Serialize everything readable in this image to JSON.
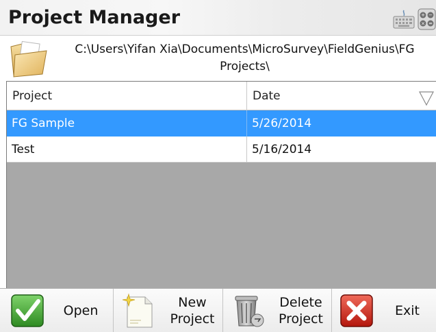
{
  "titlebar": {
    "title": "Project Manager",
    "icons": [
      "keyboard-icon",
      "calculator-icon"
    ]
  },
  "path": {
    "text": "C:\\Users\\Yifan Xia\\Documents\\MicroSurvey\\FieldGenius\\FG Projects\\",
    "icon": "folder-icon"
  },
  "table": {
    "columns": [
      "Project",
      "Date"
    ],
    "rows": [
      {
        "project": "FG Sample",
        "date": "5/26/2014",
        "selected": true
      },
      {
        "project": "Test",
        "date": "5/16/2014",
        "selected": false
      }
    ],
    "selection_color": "#3399ff"
  },
  "toolbar": {
    "open_label": "Open",
    "new_label": "New\nProject",
    "delete_label": "Delete\nProject",
    "exit_label": "Exit"
  }
}
